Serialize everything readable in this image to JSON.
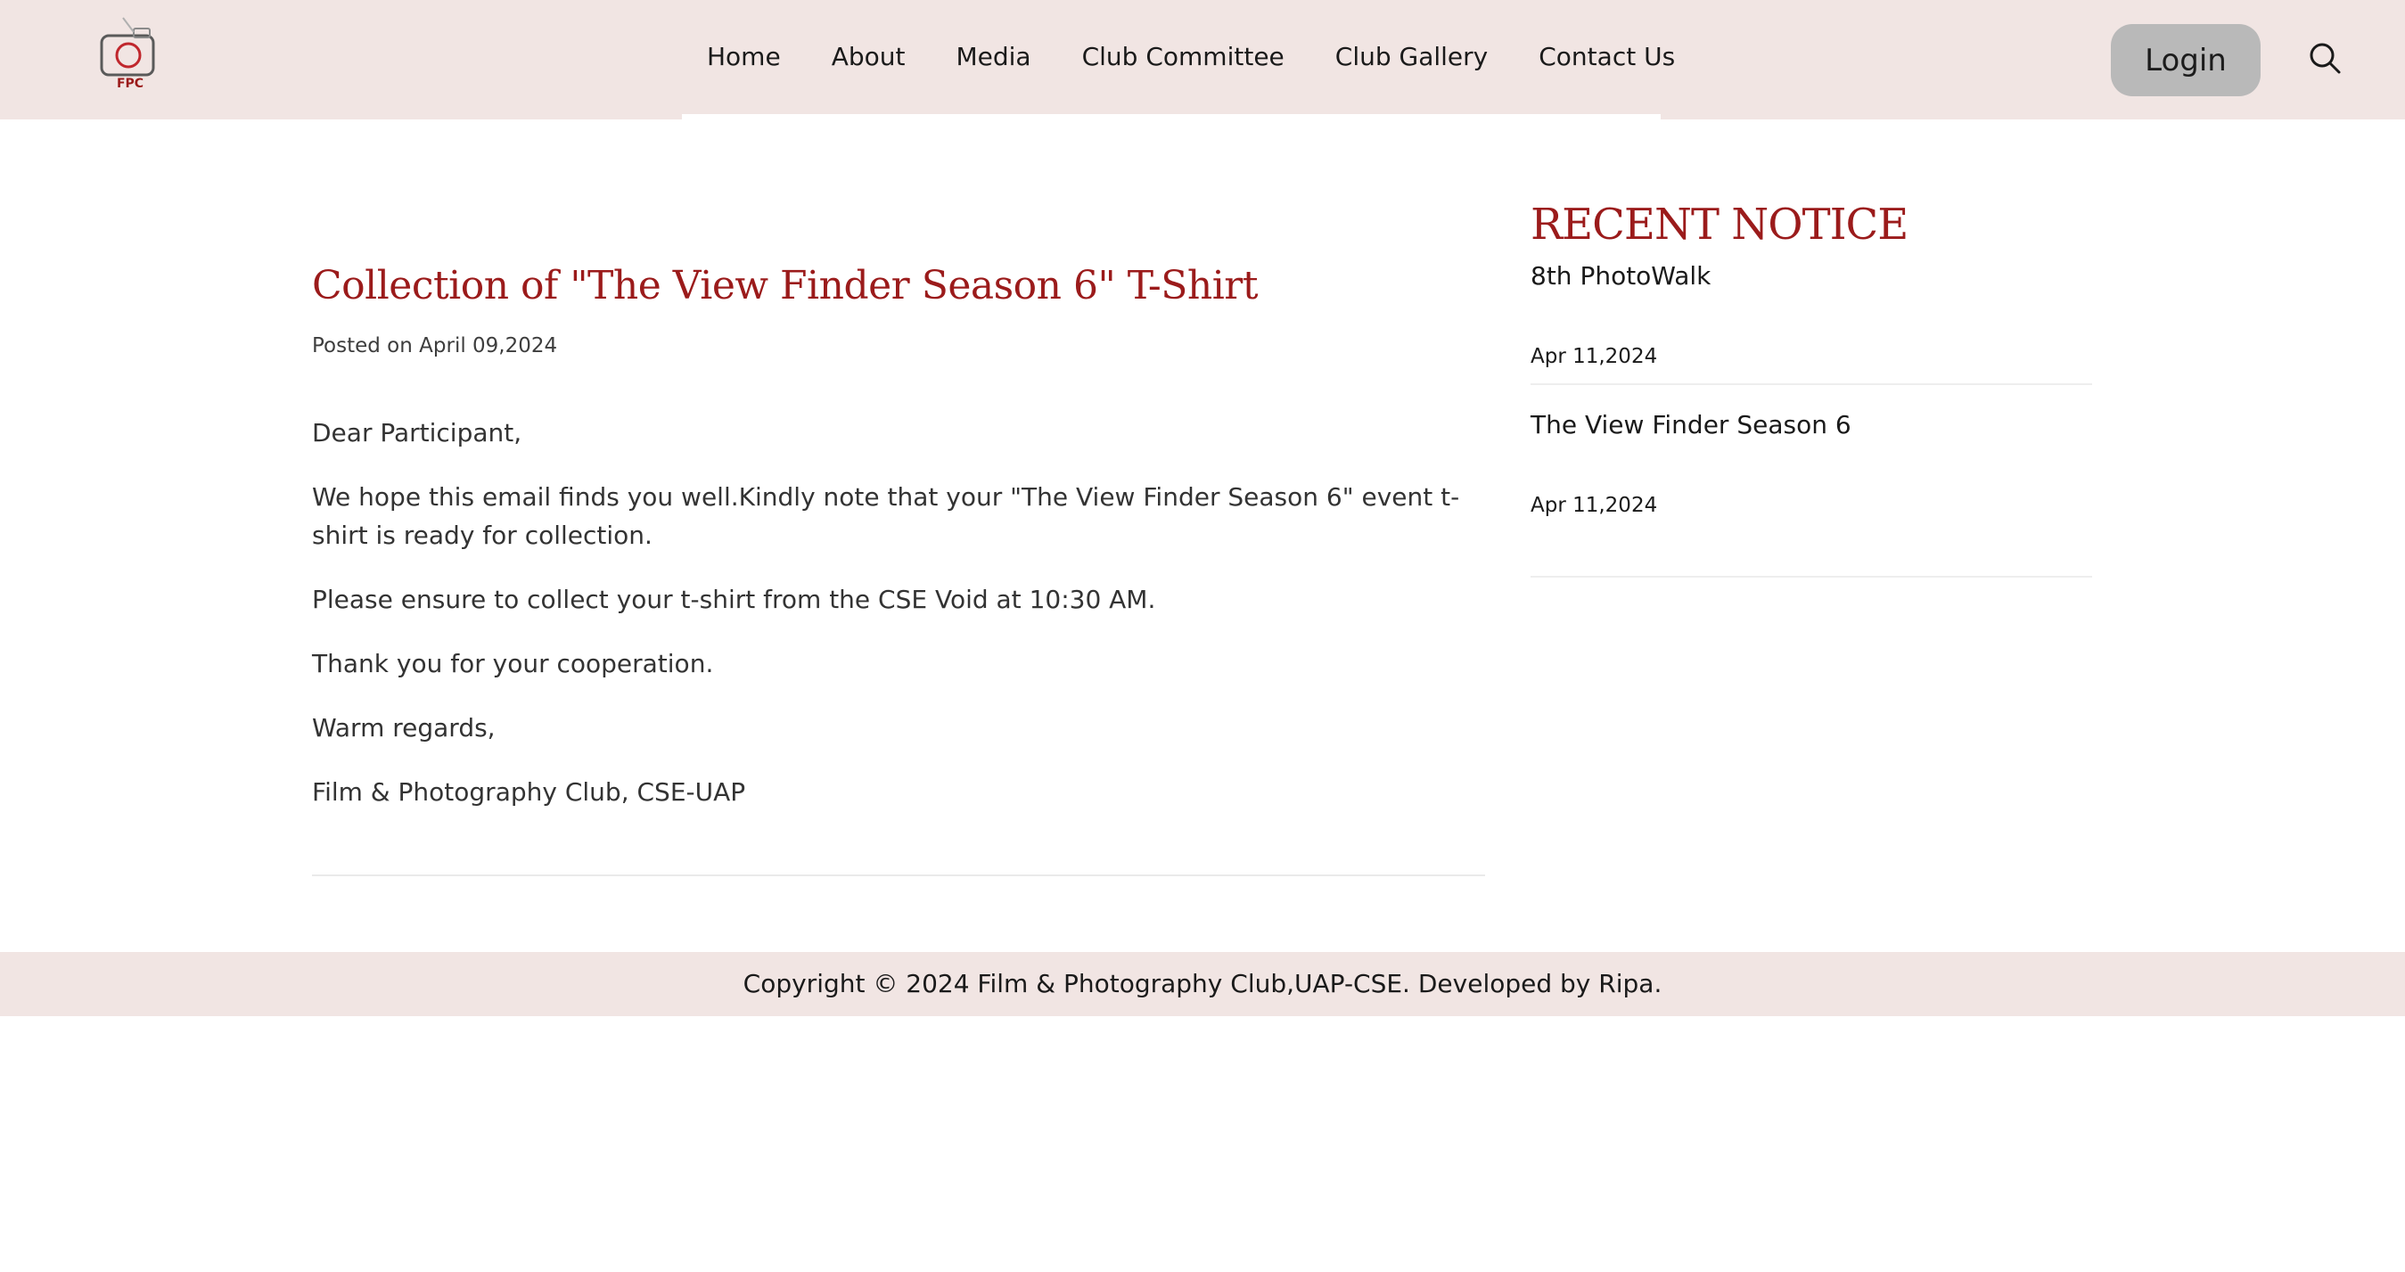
{
  "header": {
    "logo_text": "FPC",
    "nav": [
      {
        "label": "Home"
      },
      {
        "label": "About"
      },
      {
        "label": "Media"
      },
      {
        "label": "Club Committee"
      },
      {
        "label": "Club Gallery"
      },
      {
        "label": "Contact Us"
      }
    ],
    "login_label": "Login",
    "search_icon": "search-icon"
  },
  "article": {
    "title": "Collection of \"The View Finder Season 6\" T-Shirt",
    "posted_prefix": "Posted on",
    "posted_date": "April 09,2024",
    "paragraphs": [
      "Dear Participant,",
      "We hope this email finds you well.Kindly note that your \"The View Finder Season 6\" event t-shirt is ready for collection.",
      "Please ensure to collect your t-shirt from the CSE Void at 10:30 AM.",
      "Thank you for your cooperation.",
      "Warm regards,",
      "Film & Photography Club, CSE-UAP"
    ]
  },
  "sidebar": {
    "title": "RECENT NOTICE",
    "notices": [
      {
        "title": "8th PhotoWalk",
        "date": "Apr 11,2024"
      },
      {
        "title": "The View Finder Season 6",
        "date": "Apr 11,2024"
      }
    ]
  },
  "footer": {
    "text": "Copyright © 2024 Film & Photography Club,UAP-CSE. Developed by Ripa."
  },
  "colors": {
    "accent": "#9b1b1b",
    "header_bg": "#f1e5e3",
    "button_bg": "#b9b9b9"
  }
}
